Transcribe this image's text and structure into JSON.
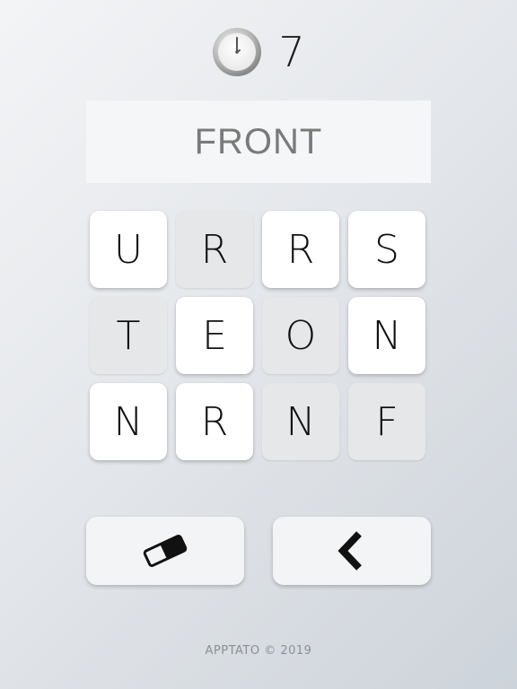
{
  "timer": {
    "icon": "clock-icon",
    "value": "7"
  },
  "word": "FRONT",
  "grid": {
    "tiles": [
      {
        "letter": "U",
        "state": "active"
      },
      {
        "letter": "R",
        "state": "used"
      },
      {
        "letter": "R",
        "state": "active"
      },
      {
        "letter": "S",
        "state": "active"
      },
      {
        "letter": "T",
        "state": "used"
      },
      {
        "letter": "E",
        "state": "active"
      },
      {
        "letter": "O",
        "state": "used"
      },
      {
        "letter": "N",
        "state": "active"
      },
      {
        "letter": "N",
        "state": "active"
      },
      {
        "letter": "R",
        "state": "active"
      },
      {
        "letter": "N",
        "state": "used"
      },
      {
        "letter": "F",
        "state": "used"
      }
    ]
  },
  "controls": {
    "erase_icon": "eraser-icon",
    "back_icon": "chevron-left-icon"
  },
  "footer": "APPTATO © 2019",
  "colors": {
    "tile_active": "#ffffff",
    "tile_used": "#e5e7e9",
    "word_text": "#7a7a7a"
  }
}
